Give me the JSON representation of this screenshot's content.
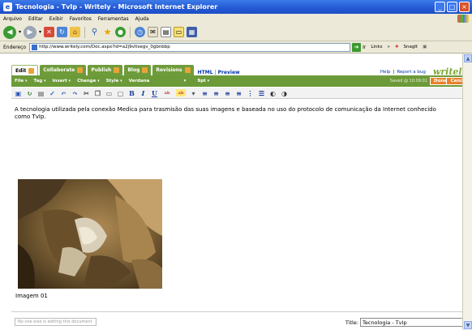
{
  "window": {
    "title": "Tecnologia - TvIp - Writely - Microsoft Internet Explorer",
    "min": "_",
    "max": "□",
    "close": "×"
  },
  "menu": [
    "Arquivo",
    "Editar",
    "Exibir",
    "Favoritos",
    "Ferramentas",
    "Ajuda"
  ],
  "address": {
    "label": "Endereço",
    "url": "http://www.writely.com/Doc.aspx?id=a2j9vltsegv_0gbnbbp",
    "go": "Ir",
    "links": "Links",
    "snagit": "SnagIt"
  },
  "app": {
    "brand": "writely",
    "help": "Help",
    "report": "Report a bug",
    "link_sep": "|",
    "tabs": [
      {
        "label": "Edit"
      },
      {
        "label": "Collaborate"
      },
      {
        "label": "Publish"
      },
      {
        "label": "Blog"
      },
      {
        "label": "Revisions"
      }
    ],
    "links": [
      {
        "label": "HTML"
      },
      {
        "label": "Preview"
      }
    ],
    "format_menu": [
      "File",
      "Tag",
      "Insert",
      "Change",
      "Style",
      "Verdana",
      "9pt"
    ],
    "saved_status": "Saved @ 10:09:01",
    "done": "Done",
    "cancel": "Cancel"
  },
  "document": {
    "text": "A tecnologia utilizada pela conexão Medica para trasmisão das suas imagens e baseada no uso do protocolo de comunicação da Internet conhecido como TvIp.",
    "caption": "Imagem 01"
  },
  "footer": {
    "collab_msg": "No one else is editing this document.",
    "title_label": "Title:",
    "title_value": "Tecnologia - TvIp"
  }
}
